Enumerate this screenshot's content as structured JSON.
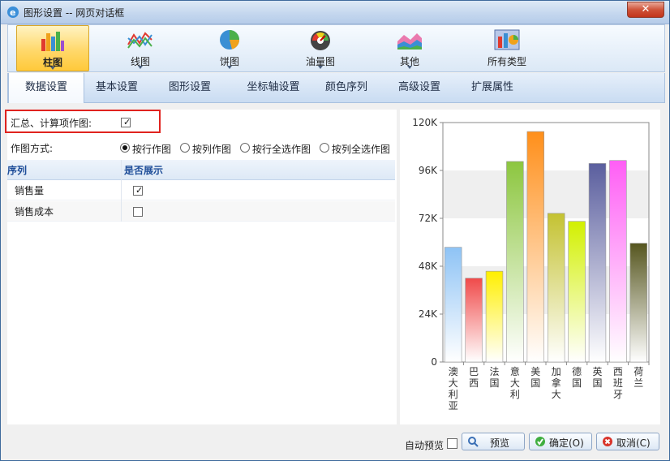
{
  "window": {
    "title": "图形设置 -- 网页对话框",
    "close": "✕"
  },
  "ribbon": [
    {
      "label": "柱图",
      "icon": "bar-chart-icon",
      "active": true
    },
    {
      "label": "线图",
      "icon": "line-chart-icon",
      "active": false
    },
    {
      "label": "饼图",
      "icon": "pie-chart-icon",
      "active": false
    },
    {
      "label": "油量图",
      "icon": "gauge-chart-icon",
      "active": false
    },
    {
      "label": "其他",
      "icon": "area-chart-icon",
      "active": false
    },
    {
      "label": "所有类型",
      "icon": "all-types-icon",
      "active": false
    }
  ],
  "tabs": [
    "数据设置",
    "基本设置",
    "图形设置",
    "坐标轴设置",
    "颜色序列",
    "高级设置",
    "扩展属性"
  ],
  "settings": {
    "summary_label": "汇总、计算项作图:",
    "summary_checked": true,
    "mode_label": "作图方式:",
    "modes": [
      {
        "label": "按行作图",
        "selected": true
      },
      {
        "label": "按列作图",
        "selected": false
      },
      {
        "label": "按行全选作图",
        "selected": false
      },
      {
        "label": "按列全选作图",
        "selected": false
      }
    ]
  },
  "table": {
    "headers": [
      "序列",
      "是否展示"
    ],
    "rows": [
      {
        "name": "销售量",
        "checked": true
      },
      {
        "name": "销售成本",
        "checked": false
      }
    ]
  },
  "chart_data": {
    "type": "bar",
    "categories": [
      "澳大利亚",
      "巴西",
      "法国",
      "意大利",
      "美国",
      "加拿大",
      "德国",
      "英国",
      "西班牙",
      "荷兰"
    ],
    "values": [
      57500,
      42000,
      45500,
      100500,
      115500,
      74500,
      70500,
      99500,
      101000,
      59500
    ],
    "ylim": [
      0,
      120000
    ],
    "yticks": [
      "0",
      "24K",
      "48K",
      "72K",
      "96K",
      "120K"
    ],
    "colors": [
      "#8ec3f5",
      "#f04a4a",
      "#ffef00",
      "#8cc63f",
      "#ff8f1a",
      "#c4c231",
      "#d2f000",
      "#5a5e9e",
      "#ff5ef5",
      "#56561f"
    ]
  },
  "footer": {
    "auto_preview": "自动预览",
    "preview": "预览",
    "ok": "确定(O)",
    "cancel": "取消(C)"
  }
}
